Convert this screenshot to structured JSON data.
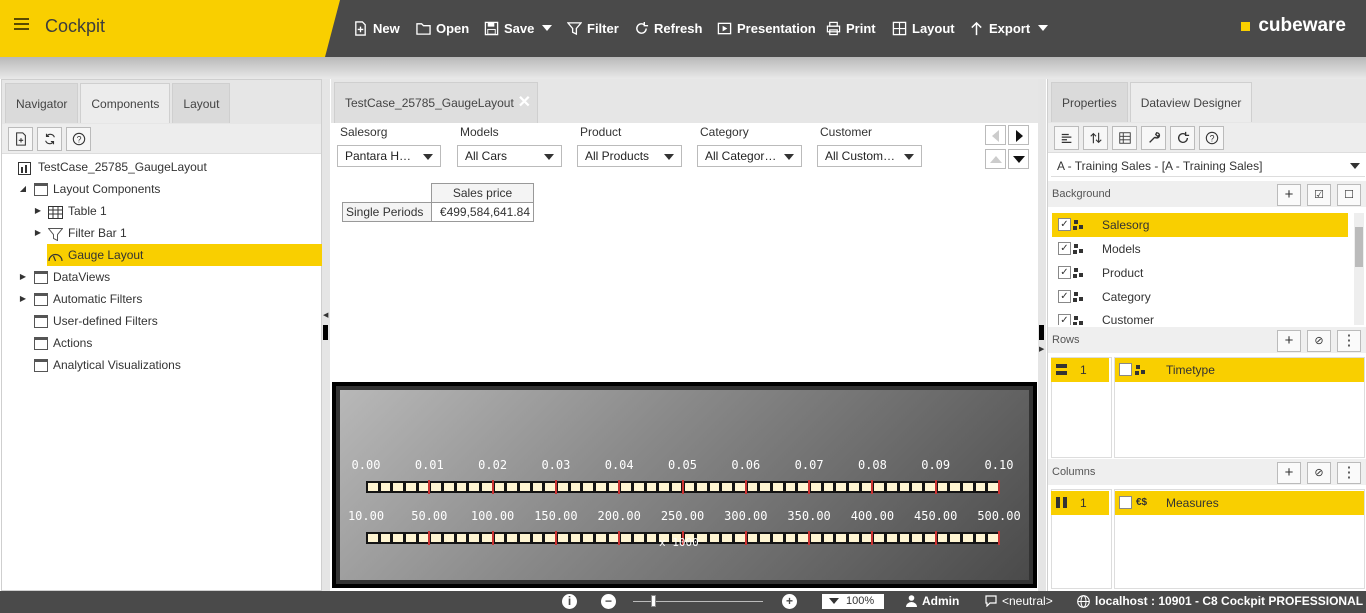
{
  "app": {
    "title": "Cockpit",
    "brand": "cubeware"
  },
  "toolbar": {
    "new": "New",
    "open": "Open",
    "save": "Save",
    "filter": "Filter",
    "refresh": "Refresh",
    "presentation": "Presentation",
    "print": "Print",
    "layout": "Layout",
    "export": "Export"
  },
  "left": {
    "tabs": [
      "Navigator",
      "Components",
      "Layout"
    ],
    "tree": [
      {
        "label": "TestCase_25785_GaugeLayout"
      },
      {
        "label": "Layout Components"
      },
      {
        "label": "Table 1"
      },
      {
        "label": "Filter Bar 1"
      },
      {
        "label": "Gauge Layout"
      },
      {
        "label": "DataViews"
      },
      {
        "label": "Automatic Filters"
      },
      {
        "label": "User-defined Filters"
      },
      {
        "label": "Actions"
      },
      {
        "label": "Analytical Visualizations"
      }
    ]
  },
  "center": {
    "tab": "TestCase_25785_GaugeLayout",
    "filters": [
      {
        "label": "Salesorg",
        "value": "Pantara H…"
      },
      {
        "label": "Models",
        "value": "All Cars"
      },
      {
        "label": "Product",
        "value": "All Products"
      },
      {
        "label": "Category",
        "value": "All Categor…"
      },
      {
        "label": "Customer",
        "value": "All Custom…"
      }
    ],
    "table": {
      "header": "Sales price",
      "row_label": "Single Periods",
      "value": "€499,584,641.84"
    },
    "gauge": {
      "scale1": [
        "0.00",
        "0.01",
        "0.02",
        "0.03",
        "0.04",
        "0.05",
        "0.06",
        "0.07",
        "0.08",
        "0.09",
        "0.10"
      ],
      "scale2": [
        "10.00",
        "50.00",
        "100.00",
        "150.00",
        "200.00",
        "250.00",
        "300.00",
        "350.00",
        "400.00",
        "450.00",
        "500.00"
      ],
      "multiplier": "x 1000"
    }
  },
  "right": {
    "tabs": [
      "Properties",
      "Dataview Designer"
    ],
    "dataview": "A - Training Sales - [A - Training Sales]",
    "background_label": "Background",
    "background_items": [
      "Salesorg",
      "Models",
      "Product",
      "Category",
      "Customer"
    ],
    "rows_label": "Rows",
    "rows_num": "1",
    "rows_item": "Timetype",
    "columns_label": "Columns",
    "columns_num": "1",
    "columns_item": "Measures"
  },
  "status": {
    "zoom": "100%",
    "user": "Admin",
    "neutral": "<neutral>",
    "server": "localhost : 10901 - C8 Cockpit PROFESSIONAL"
  }
}
